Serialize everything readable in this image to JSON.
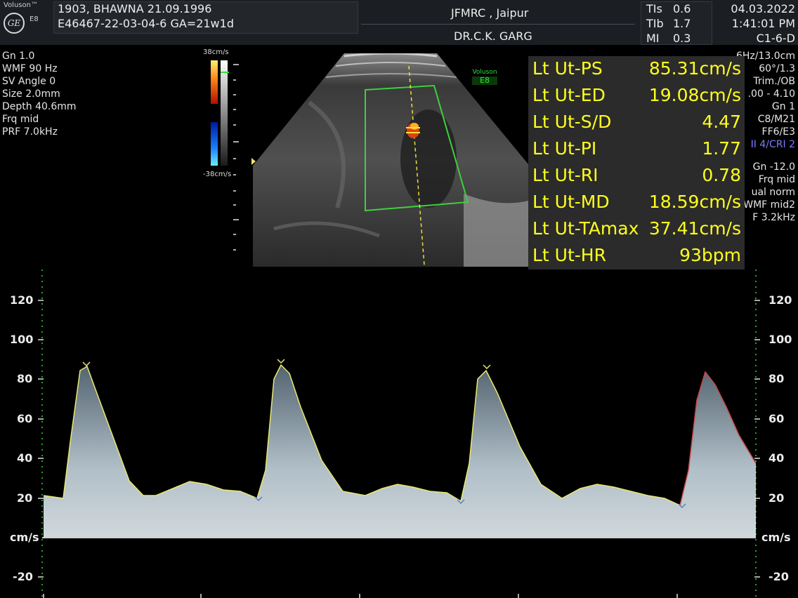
{
  "brand": {
    "name": "Voluson™",
    "model": "E8",
    "logo": "GE"
  },
  "patient": {
    "line1": "1903, BHAWNA  21.09.1996",
    "line2": "E46467-22-03-04-6  GA=21w1d"
  },
  "institution": {
    "name": "JFMRC , Jaipur",
    "doctor": "DR.C.K. GARG"
  },
  "indices": [
    {
      "label": "TIs",
      "value": "0.6"
    },
    {
      "label": "TIb",
      "value": "1.7"
    },
    {
      "label": "MI",
      "value": "0.3"
    }
  ],
  "datetime": {
    "date": "04.03.2022",
    "time": "1:41:01 PM",
    "probe": "C1-6-D"
  },
  "left_params": [
    "Gn  1.0",
    "WMF 90 Hz",
    "SV Angle  0",
    "Size  2.0mm",
    "Depth 40.6mm",
    "Frq mid",
    "PRF  7.0kHz"
  ],
  "right_params": {
    "top": [
      "6Hz/13.0cm",
      "60°/1.3",
      "Trim./OB",
      ".00 - 4.10",
      "Gn  1",
      "C8/M21",
      "FF6/E3"
    ],
    "highlight": "II 4/CRI 2",
    "bottom": [
      "Gn -12.0",
      "Frq mid",
      "ual norm",
      "WMF mid2",
      "F  3.2kHz"
    ]
  },
  "color_scale": {
    "top": "38cm/s",
    "bottom": "-38cm/s"
  },
  "mini_logo": {
    "name": "Voluson",
    "model": "E8"
  },
  "measurements": [
    {
      "label": "Lt Ut-PS",
      "value": "85.31cm/s"
    },
    {
      "label": "Lt Ut-ED",
      "value": "19.08cm/s"
    },
    {
      "label": "Lt Ut-S/D",
      "value": "4.47"
    },
    {
      "label": "Lt Ut-PI",
      "value": "1.77"
    },
    {
      "label": "Lt Ut-RI",
      "value": "0.78"
    },
    {
      "label": "Lt Ut-MD",
      "value": "18.59cm/s"
    },
    {
      "label": "Lt Ut-TAmax",
      "value": "37.41cm/s"
    },
    {
      "label": "Lt Ut-HR",
      "value": "93bpm"
    }
  ],
  "doppler_axis": {
    "ticks": [
      "120",
      "100",
      "80",
      "60",
      "40",
      "20"
    ],
    "negative": "-20",
    "unit": "cm/s"
  },
  "colors": {
    "measurement_text": "#ffff1e",
    "envelope": "#e8e870",
    "roi_box": "#3fcf3f",
    "highlight": "#7b7bff"
  }
}
